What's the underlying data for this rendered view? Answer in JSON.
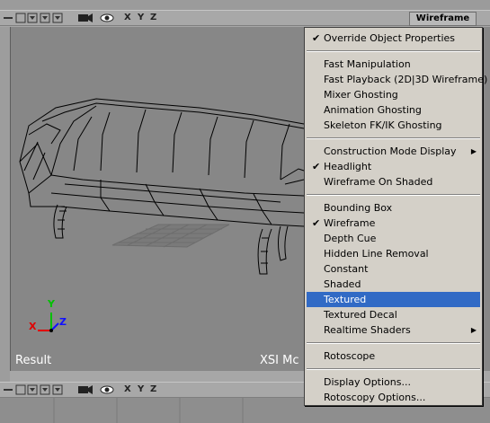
{
  "toolbar": {
    "axes": [
      "X",
      "Y",
      "Z"
    ],
    "view_menu_label": "Wireframe"
  },
  "viewport": {
    "label_left": "Result",
    "label_right": "XSI Mc",
    "gizmo_axes": [
      "X",
      "Y",
      "Z"
    ]
  },
  "menu": {
    "items": [
      {
        "label": "Override Object Properties",
        "checked": true
      },
      {
        "label": "Fast Manipulation"
      },
      {
        "label": "Fast Playback (2D|3D Wireframe)"
      },
      {
        "label": "Mixer Ghosting"
      },
      {
        "label": "Animation Ghosting"
      },
      {
        "label": "Skeleton FK/IK Ghosting"
      },
      {
        "label": "Construction Mode Display",
        "submenu": true
      },
      {
        "label": "Headlight",
        "checked": true
      },
      {
        "label": "Wireframe On Shaded"
      },
      {
        "label": "Bounding Box"
      },
      {
        "label": "Wireframe",
        "checked": true
      },
      {
        "label": "Depth Cue"
      },
      {
        "label": "Hidden Line Removal"
      },
      {
        "label": "Constant"
      },
      {
        "label": "Shaded"
      },
      {
        "label": "Textured",
        "selected": true
      },
      {
        "label": "Textured Decal"
      },
      {
        "label": "Realtime Shaders",
        "submenu": true
      },
      {
        "label": "Rotoscope"
      },
      {
        "label": "Display Options..."
      },
      {
        "label": "Rotoscopy Options..."
      }
    ]
  },
  "colors": {
    "menu_bg": "#d4d0c8",
    "selection": "#316ac5",
    "viewport_bg": "#878787",
    "gizmo_x": "#e00000",
    "gizmo_y": "#00c000",
    "gizmo_z": "#1010ff"
  }
}
